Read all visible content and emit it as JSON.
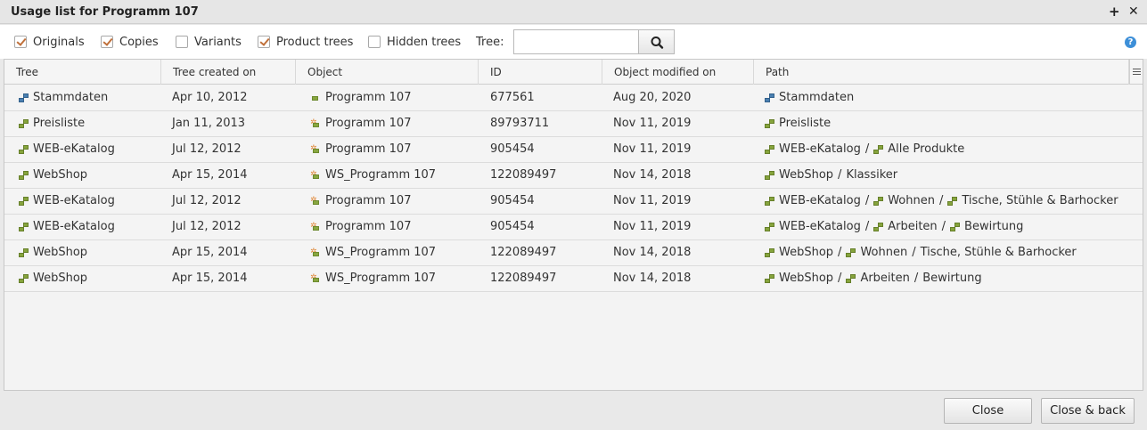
{
  "window": {
    "title": "Usage list for Programm 107",
    "maximize_glyph": "+",
    "close_glyph": "✕"
  },
  "toolbar": {
    "checkboxes": [
      {
        "label": "Originals",
        "checked": true
      },
      {
        "label": "Copies",
        "checked": true
      },
      {
        "label": "Variants",
        "checked": false
      },
      {
        "label": "Product trees",
        "checked": true
      },
      {
        "label": "Hidden trees",
        "checked": false
      }
    ],
    "tree_label": "Tree:",
    "tree_value": "",
    "help_glyph": "?"
  },
  "columns": [
    "Tree",
    "Tree created on",
    "Object",
    "ID",
    "Object modified on",
    "Path"
  ],
  "rows": [
    {
      "tree": "Stammdaten",
      "tree_icon": "blue-tree",
      "created": "Apr 10, 2012",
      "object": "Programm 107",
      "object_icon": "original",
      "id": "677561",
      "modified": "Aug 20, 2020",
      "path": [
        {
          "name": "Stammdaten",
          "icon": "blue-tree"
        }
      ]
    },
    {
      "tree": "Preisliste",
      "tree_icon": "green-tree",
      "created": "Jan 11, 2013",
      "object": "Programm 107",
      "object_icon": "copy",
      "id": "89793711",
      "modified": "Nov 11, 2019",
      "path": [
        {
          "name": "Preisliste",
          "icon": "green-tree"
        }
      ]
    },
    {
      "tree": "WEB-eKatalog",
      "tree_icon": "green-tree",
      "created": "Jul 12, 2012",
      "object": "Programm 107",
      "object_icon": "copy",
      "id": "905454",
      "modified": "Nov 11, 2019",
      "path": [
        {
          "name": "WEB-eKatalog",
          "icon": "green-tree"
        },
        {
          "name": "Alle Produkte",
          "icon": "green-tree"
        }
      ]
    },
    {
      "tree": "WebShop",
      "tree_icon": "green-tree",
      "created": "Apr 15, 2014",
      "object": "WS_Programm 107",
      "object_icon": "copy",
      "id": "122089497",
      "modified": "Nov 14, 2018",
      "path": [
        {
          "name": "WebShop",
          "icon": "green-tree"
        },
        {
          "name": "Klassiker",
          "icon": "none"
        }
      ]
    },
    {
      "tree": "WEB-eKatalog",
      "tree_icon": "green-tree",
      "created": "Jul 12, 2012",
      "object": "Programm 107",
      "object_icon": "copy",
      "id": "905454",
      "modified": "Nov 11, 2019",
      "path": [
        {
          "name": "WEB-eKatalog",
          "icon": "green-tree"
        },
        {
          "name": "Wohnen",
          "icon": "green-tree"
        },
        {
          "name": "Tische, Stühle & Barhocker",
          "icon": "green-tree"
        }
      ]
    },
    {
      "tree": "WEB-eKatalog",
      "tree_icon": "green-tree",
      "created": "Jul 12, 2012",
      "object": "Programm 107",
      "object_icon": "copy",
      "id": "905454",
      "modified": "Nov 11, 2019",
      "path": [
        {
          "name": "WEB-eKatalog",
          "icon": "green-tree"
        },
        {
          "name": "Arbeiten",
          "icon": "green-tree"
        },
        {
          "name": "Bewirtung",
          "icon": "green-tree"
        }
      ]
    },
    {
      "tree": "WebShop",
      "tree_icon": "green-tree",
      "created": "Apr 15, 2014",
      "object": "WS_Programm 107",
      "object_icon": "copy",
      "id": "122089497",
      "modified": "Nov 14, 2018",
      "path": [
        {
          "name": "WebShop",
          "icon": "green-tree"
        },
        {
          "name": "Wohnen",
          "icon": "green-tree"
        },
        {
          "name": "Tische, Stühle & Barhocker",
          "icon": "none"
        }
      ]
    },
    {
      "tree": "WebShop",
      "tree_icon": "green-tree",
      "created": "Apr 15, 2014",
      "object": "WS_Programm 107",
      "object_icon": "copy",
      "id": "122089497",
      "modified": "Nov 14, 2018",
      "path": [
        {
          "name": "WebShop",
          "icon": "green-tree"
        },
        {
          "name": "Arbeiten",
          "icon": "green-tree"
        },
        {
          "name": "Bewirtung",
          "icon": "none"
        }
      ]
    }
  ],
  "footer": {
    "close_label": "Close",
    "close_back_label": "Close & back"
  },
  "colors": {
    "blue_tree": "#4a7fb0",
    "green_tree": "#86a43c",
    "copy_star": "#e08a3c",
    "check": "#c0703a",
    "help": "#3d8fd8"
  }
}
